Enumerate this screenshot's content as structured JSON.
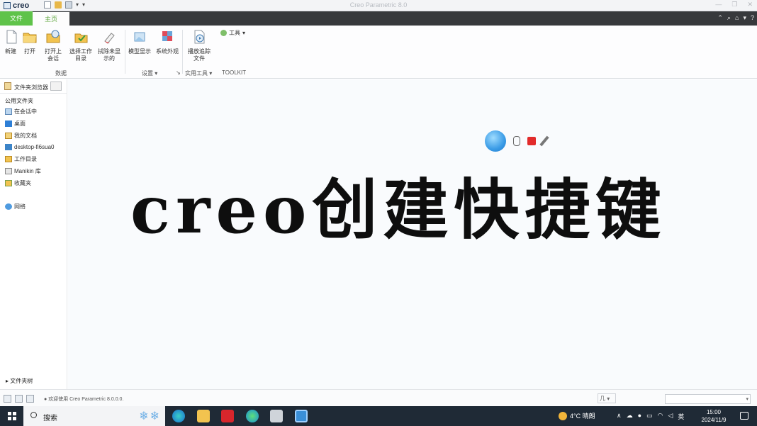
{
  "window": {
    "logo_text": "creo",
    "title": "Creo Parametric 8.0"
  },
  "tabs": {
    "file": "文件",
    "home": "主页"
  },
  "ribbon": {
    "buttons": {
      "new": "新建",
      "open": "打开",
      "open_session_1": "打开上",
      "open_session_2": "会话",
      "select_wd_1": "选择工作",
      "select_wd_2": "目录",
      "erase_1": "拭除未显",
      "erase_2": "示的",
      "model_display": "模型显示",
      "system_appearance": "系统外观",
      "play_trail_1": "播放追踪",
      "play_trail_2": "文件",
      "tools": "工具"
    },
    "groups": {
      "data": "数据",
      "settings": "设置",
      "utilities": "实用工具",
      "toolkit": "TOOLKIT"
    }
  },
  "navigator": {
    "header": "文件夹浏览器",
    "section": "公用文件夹",
    "items": [
      {
        "label": "在会话中",
        "icon": "session-icon"
      },
      {
        "label": "桌面",
        "icon": "desktop-icon"
      },
      {
        "label": "我的文档",
        "icon": "documents-icon"
      },
      {
        "label": "desktop-fi6sua0",
        "icon": "computer-icon"
      },
      {
        "label": "工作目录",
        "icon": "working-directory-icon"
      },
      {
        "label": "Manikin 库",
        "icon": "manikin-library-icon"
      },
      {
        "label": "收藏夹",
        "icon": "favorites-icon"
      },
      {
        "label": "网络",
        "icon": "network-icon"
      }
    ],
    "footer": "文件夹树"
  },
  "canvas": {
    "title": "creo创建快捷键"
  },
  "status": {
    "message": "欢迎使用 Creo Parametric 8.0.0.0.",
    "filter_label": "几"
  },
  "taskbar": {
    "search": "搜索",
    "weather": "4°C 晴朗",
    "ime": "英",
    "time": "15:00",
    "date": "2024/11/9"
  }
}
